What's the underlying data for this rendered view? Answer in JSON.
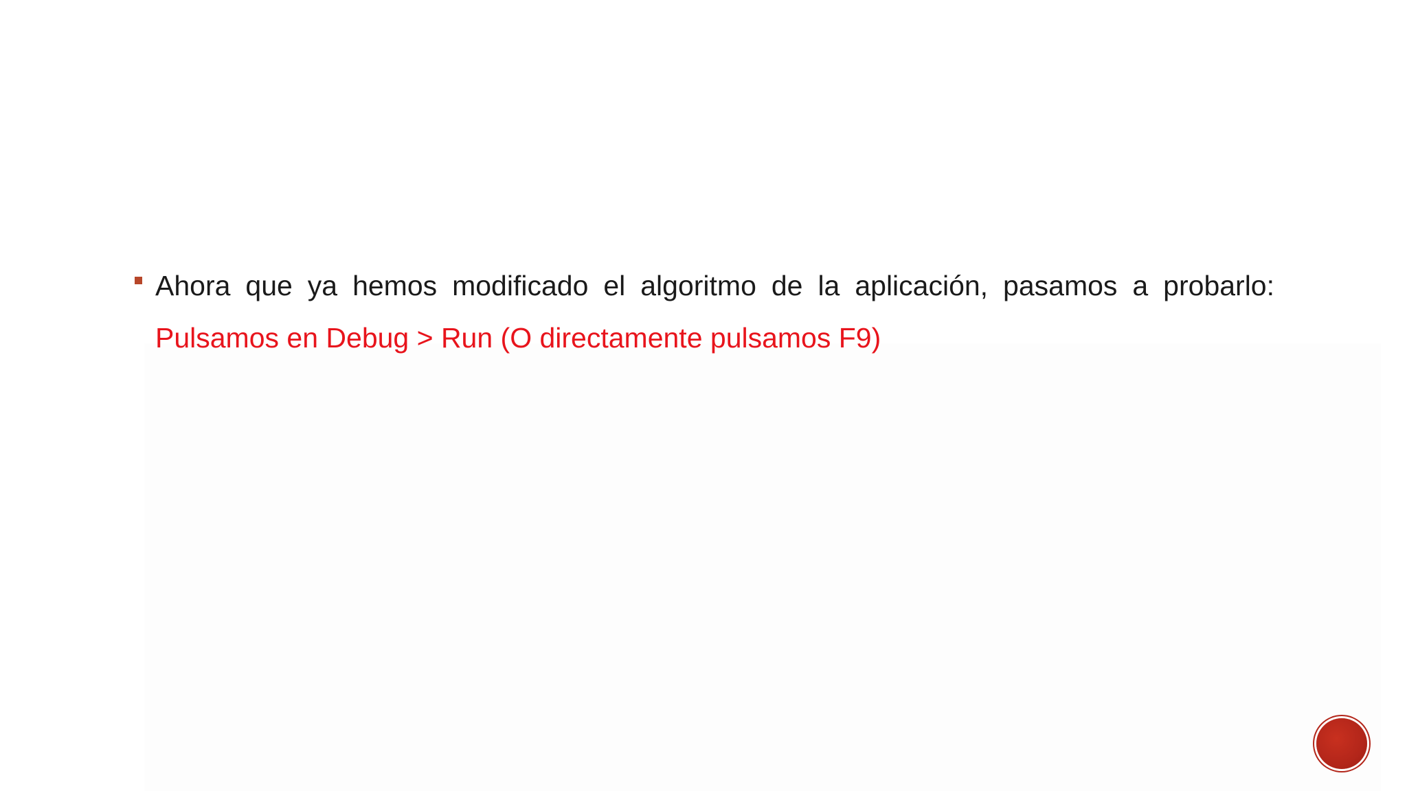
{
  "slide": {
    "bullets": [
      {
        "line1": "Ahora que ya hemos modificado el algoritmo de la aplicación, pasamos a probarlo:",
        "line2": "Pulsamos en Debug > Run (O directamente pulsamos F9)"
      }
    ],
    "colors": {
      "text": "#1a1a1a",
      "highlight": "#e8141c",
      "bullet": "#b7472a",
      "badge": "#b3261a"
    },
    "icons": {
      "bullet": "square-bullet-icon",
      "badge": "slide-number-badge-icon"
    }
  }
}
